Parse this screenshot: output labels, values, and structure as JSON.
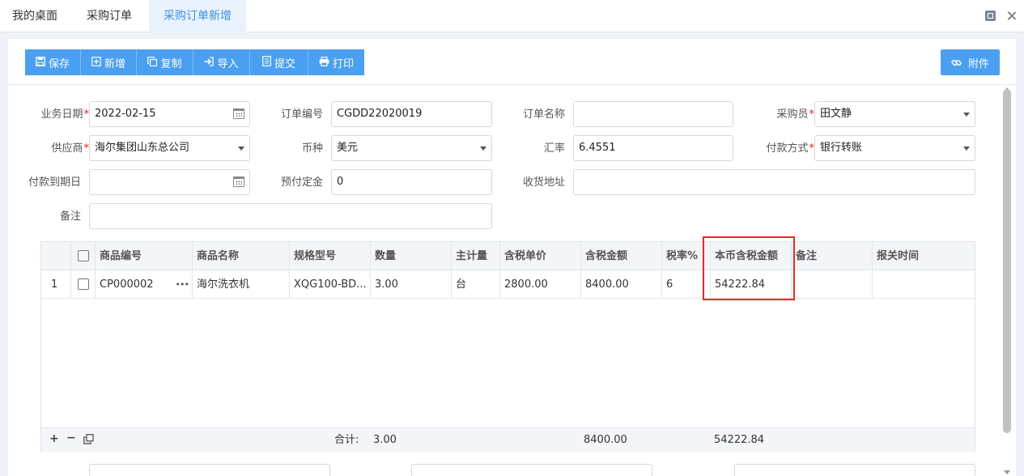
{
  "tabs": [
    {
      "label": "我的桌面"
    },
    {
      "label": "采购订单"
    },
    {
      "label": "采购订单新增",
      "active": true
    }
  ],
  "toolbar": {
    "buttons": [
      {
        "label": "保存",
        "icon": "save-icon"
      },
      {
        "label": "新增",
        "icon": "add-icon"
      },
      {
        "label": "复制",
        "icon": "copy-icon"
      },
      {
        "label": "导入",
        "icon": "import-icon"
      },
      {
        "label": "提交",
        "icon": "submit-icon"
      },
      {
        "label": "打印",
        "icon": "print-icon"
      }
    ],
    "attach_label": "附件"
  },
  "form": {
    "biz_date": {
      "label": "业务日期",
      "value": "2022-02-15",
      "required": true
    },
    "order_no": {
      "label": "订单编号",
      "value": "CGDD22020019"
    },
    "order_name": {
      "label": "订单名称",
      "value": ""
    },
    "buyer": {
      "label": "采购员",
      "value": "田文静",
      "required": true
    },
    "supplier": {
      "label": "供应商",
      "value": "海尔集团山东总公司",
      "required": true
    },
    "currency": {
      "label": "币种",
      "value": "美元"
    },
    "exchange_rate": {
      "label": "汇率",
      "value": "6.4551"
    },
    "pay_method": {
      "label": "付款方式",
      "value": "银行转账",
      "required": true
    },
    "due_date": {
      "label": "付款到期日",
      "value": ""
    },
    "deposit": {
      "label": "预付定金",
      "value": "0"
    },
    "address": {
      "label": "收货地址",
      "value": ""
    },
    "remark": {
      "label": "备注",
      "value": ""
    }
  },
  "grid": {
    "columns": [
      "商品编号",
      "商品名称",
      "规格型号",
      "数量",
      "主计量",
      "含税单价",
      "含税金额",
      "税率%",
      "本币含税金额",
      "备注",
      "报关时间"
    ],
    "rows": [
      {
        "index": "1",
        "code": "CP000002",
        "name": "海尔洗衣机",
        "spec": "XQG100-BD...",
        "qty": "3.00",
        "unit": "台",
        "price": "2800.00",
        "amount": "8400.00",
        "tax_rate": "6",
        "local_amount": "54222.84",
        "remark": "",
        "customs_time": ""
      }
    ],
    "footer": {
      "total_label": "合计:",
      "qty": "3.00",
      "amount": "8400.00",
      "local_amount": "54222.84"
    }
  },
  "colors": {
    "accent": "#4a9ff0",
    "active_tab": "#3a8ee6",
    "highlight": "#e6282a",
    "required": "#e02020"
  }
}
